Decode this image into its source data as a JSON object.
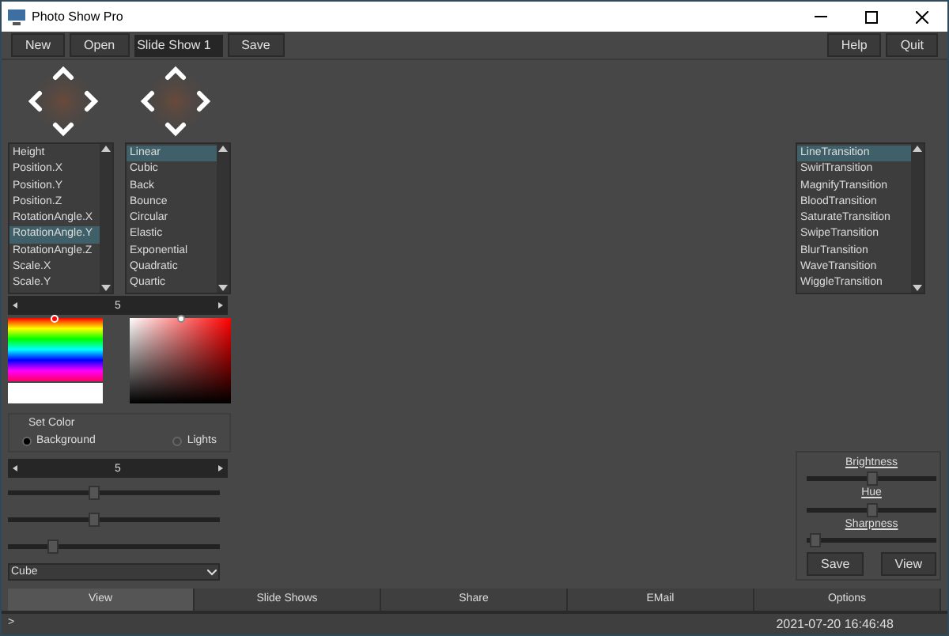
{
  "window": {
    "title": "Photo Show Pro"
  },
  "toolbar": {
    "left_buttons": [
      "New",
      "Open"
    ],
    "name_field": "Slide Show 1",
    "save_button": "Save",
    "right_buttons": [
      "Help",
      "Quit"
    ]
  },
  "property_list": {
    "items": [
      {
        "label": "Height",
        "selected": false
      },
      {
        "label": "Position.X",
        "selected": false
      },
      {
        "label": "Position.Y",
        "selected": false
      },
      {
        "label": "Position.Z",
        "selected": false
      },
      {
        "label": "RotationAngle.X",
        "selected": false
      },
      {
        "label": "RotationAngle.Y",
        "selected": true
      },
      {
        "label": "RotationAngle.Z",
        "selected": false
      },
      {
        "label": "Scale.X",
        "selected": false
      },
      {
        "label": "Scale.Y",
        "selected": false
      }
    ]
  },
  "easing_list": {
    "items": [
      {
        "label": "Linear",
        "selected": true
      },
      {
        "label": "Cubic",
        "selected": false
      },
      {
        "label": "Back",
        "selected": false
      },
      {
        "label": "Bounce",
        "selected": false
      },
      {
        "label": "Circular",
        "selected": false
      },
      {
        "label": "Elastic",
        "selected": false
      },
      {
        "label": "Exponential",
        "selected": false
      },
      {
        "label": "Quadratic",
        "selected": false
      },
      {
        "label": "Quartic",
        "selected": false
      }
    ]
  },
  "spinner_1": {
    "value": "5"
  },
  "set_color": {
    "title": "Set Color",
    "options": [
      {
        "label": "Background",
        "selected": true
      },
      {
        "label": "Lights",
        "selected": false
      }
    ]
  },
  "spinner_2": {
    "value": "5"
  },
  "sliders": [
    {
      "level": 0.4
    },
    {
      "level": 0.4
    },
    {
      "level": 0.2
    }
  ],
  "shape_dropdown": {
    "value": "Cube"
  },
  "transition_list": {
    "items": [
      {
        "label": "LineTransition",
        "selected": true
      },
      {
        "label": "SwirlTransition",
        "selected": false
      },
      {
        "label": "MagnifyTransition",
        "selected": false
      },
      {
        "label": "BloodTransition",
        "selected": false
      },
      {
        "label": "SaturateTransition",
        "selected": false
      },
      {
        "label": "SwipeTransition",
        "selected": false
      },
      {
        "label": "BlurTransition",
        "selected": false
      },
      {
        "label": "WaveTransition",
        "selected": false
      },
      {
        "label": "WiggleTransition",
        "selected": false
      }
    ]
  },
  "adjust_panel": {
    "sliders": [
      {
        "label": "Brightness",
        "level": 0.5
      },
      {
        "label": "Hue",
        "level": 0.5
      },
      {
        "label": "Sharpness",
        "level": 0.03
      }
    ],
    "buttons": [
      "Save",
      "View"
    ]
  },
  "tabs": [
    {
      "label": "View",
      "selected": true
    },
    {
      "label": "Slide Shows",
      "selected": false
    },
    {
      "label": "Share",
      "selected": false
    },
    {
      "label": "EMail",
      "selected": false
    },
    {
      "label": "Options",
      "selected": false
    }
  ],
  "status_bar": {
    "prompt": ">",
    "datetime": "2021-07-20 16:46:48"
  }
}
